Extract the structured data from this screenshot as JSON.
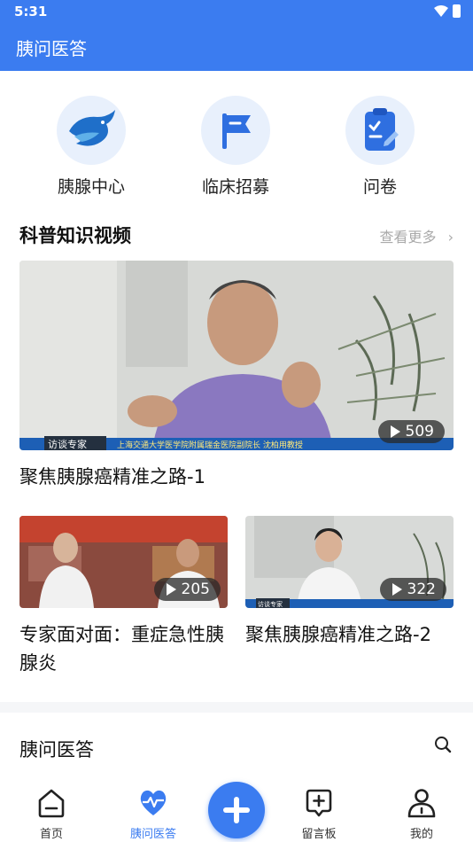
{
  "status": {
    "time": "5:31"
  },
  "appbar": {
    "title": "胰问医答"
  },
  "quick": [
    {
      "label": "胰腺中心",
      "icon": "dolphin-icon"
    },
    {
      "label": "临床招募",
      "icon": "flag-icon"
    },
    {
      "label": "问卷",
      "icon": "clipboard-icon"
    }
  ],
  "section": {
    "title": "科普知识视频",
    "more": "查看更多"
  },
  "videos": [
    {
      "title": "聚焦胰腺癌精准之路-1",
      "plays": "509",
      "caption": "访谈专家",
      "banner": "上海交通大学医学院附属瑞金医院副院长 沈柏用教授"
    },
    {
      "title": "专家面对面：重症急性胰腺炎",
      "plays": "205"
    },
    {
      "title": "聚焦胰腺癌精准之路-2",
      "plays": "322",
      "caption": "访谈专家"
    }
  ],
  "footer": {
    "title": "胰问医答"
  },
  "tabs": [
    {
      "label": "首页",
      "icon": "home-icon"
    },
    {
      "label": "胰问医答",
      "icon": "heart-pulse-icon"
    },
    {
      "label": "留言板",
      "icon": "message-add-icon"
    },
    {
      "label": "我的",
      "icon": "user-icon"
    }
  ],
  "colors": {
    "primary": "#3b7cf0",
    "icon_bg": "#e8f0fc"
  }
}
